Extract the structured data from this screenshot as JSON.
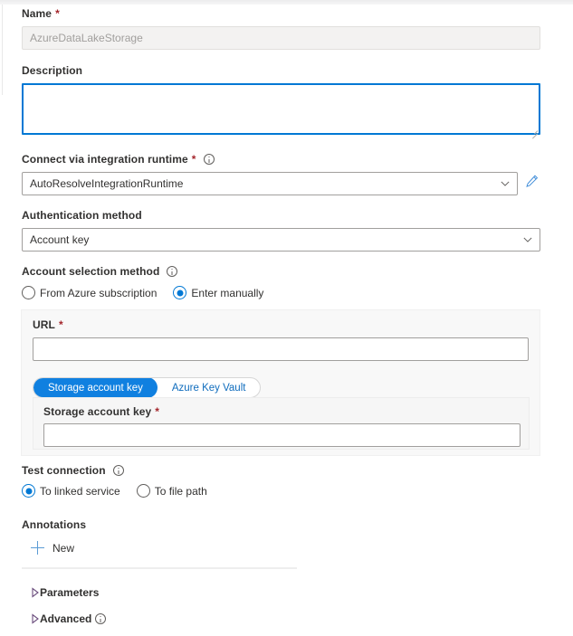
{
  "form": {
    "name": {
      "label": "Name",
      "required": "*",
      "value": "AzureDataLakeStorage"
    },
    "description": {
      "label": "Description",
      "value": ""
    },
    "integration_runtime": {
      "label": "Connect via integration runtime",
      "required": "*",
      "value": "AutoResolveIntegrationRuntime",
      "edit_icon": "pencil-icon",
      "info_icon": "info-icon"
    },
    "auth_method": {
      "label": "Authentication method",
      "value": "Account key"
    },
    "account_selection": {
      "label": "Account selection method",
      "info_icon": "info-icon",
      "options": [
        {
          "label": "From Azure subscription",
          "selected": false
        },
        {
          "label": "Enter manually",
          "selected": true
        }
      ]
    },
    "url": {
      "label": "URL",
      "required": "*",
      "value": ""
    },
    "credential_tabs": [
      {
        "label": "Storage account key",
        "active": true
      },
      {
        "label": "Azure Key Vault",
        "active": false
      }
    ],
    "storage_account_key": {
      "label": "Storage account key",
      "required": "*",
      "value": ""
    },
    "test_connection": {
      "label": "Test connection",
      "info_icon": "info-icon",
      "options": [
        {
          "label": "To linked service",
          "selected": true
        },
        {
          "label": "To file path",
          "selected": false
        }
      ]
    },
    "annotations": {
      "label": "Annotations",
      "new_label": "New",
      "plus_icon": "plus-icon"
    },
    "sections": [
      {
        "label": "Parameters",
        "expanded": false,
        "has_info": false
      },
      {
        "label": "Advanced",
        "expanded": false,
        "has_info": true
      }
    ]
  },
  "colors": {
    "accent": "#0078d4",
    "pivot_active": "#1080e0",
    "link": "#0f6cbd",
    "required": "#a4262c",
    "panel_bg": "#f8f8f8",
    "disabled_bg": "#f3f2f1"
  }
}
